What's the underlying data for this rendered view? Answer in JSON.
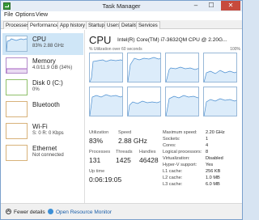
{
  "window": {
    "title": "Task Manager",
    "minimize": "–",
    "maximize": "☐",
    "close": "✕"
  },
  "menu": [
    "File",
    "Options",
    "View"
  ],
  "tabs": [
    "Processes",
    "Performance",
    "App history",
    "Startup",
    "Users",
    "Details",
    "Services"
  ],
  "sidebar": [
    {
      "name": "CPU",
      "detail": "83% 2.88 GHz",
      "color": "#4a8ed0"
    },
    {
      "name": "Memory",
      "detail": "4.0/11.9 GB (34%)",
      "color": "#8b2fb0"
    },
    {
      "name": "Disk 0 (C:)",
      "detail": "0%",
      "color": "#5aa02c"
    },
    {
      "name": "Bluetooth",
      "detail": "",
      "color": "#c78a2e"
    },
    {
      "name": "Wi-Fi",
      "detail": "S: 0 R: 0 Kbps",
      "color": "#c78a2e"
    },
    {
      "name": "Ethernet",
      "detail": "Not connected",
      "color": "#c78a2e"
    }
  ],
  "cpu": {
    "title": "CPU",
    "model": "Intel(R) Core(TM) i7-3632QM CPU @ 2.20G...",
    "util_label": "% Utilization over 60 seconds",
    "util_max": "100%",
    "stats": {
      "utilization_label": "Utilization",
      "utilization": "83%",
      "speed_label": "Speed",
      "speed": "2.88 GHz",
      "processes_label": "Processes",
      "processes": "131",
      "threads_label": "Threads",
      "threads": "1425",
      "handles_label": "Handles",
      "handles": "46428",
      "uptime_label": "Up time",
      "uptime": "0:06:19:05"
    },
    "details": [
      {
        "label": "Maximum speed:",
        "value": "2.20 GHz"
      },
      {
        "label": "Sockets:",
        "value": "1"
      },
      {
        "label": "Cores:",
        "value": "4"
      },
      {
        "label": "Logical processors:",
        "value": "8"
      },
      {
        "label": "Virtualization:",
        "value": "Disabled"
      },
      {
        "label": "Hyper-V support:",
        "value": "Yes"
      },
      {
        "label": "L1 cache:",
        "value": "256 KB"
      },
      {
        "label": "L2 cache:",
        "value": "1.0 MB"
      },
      {
        "label": "L3 cache:",
        "value": "6.0 MB"
      }
    ]
  },
  "footer": {
    "fewer_details": "Fewer details",
    "open_monitor": "Open Resource Monitor"
  }
}
